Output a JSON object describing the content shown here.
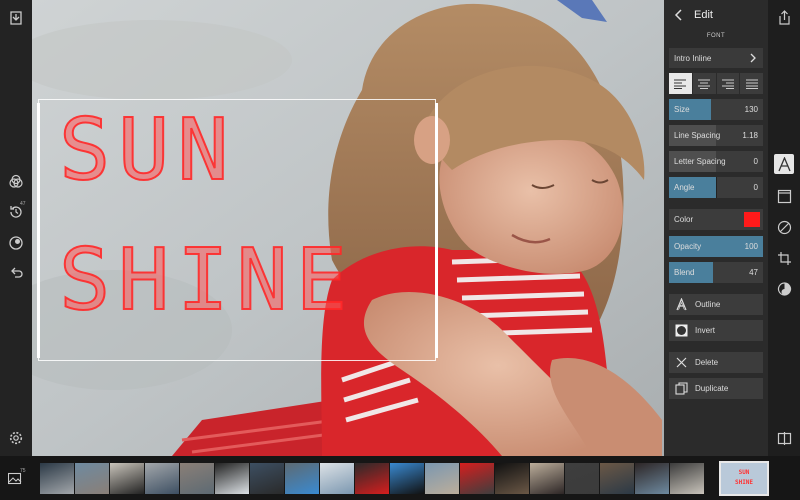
{
  "editor": {
    "back_icon": "chevron-left-icon",
    "title": "Edit",
    "section_label": "FONT",
    "font_name": "Intro Inline",
    "alignment_options": [
      "align-left",
      "align-center",
      "align-right",
      "align-justify"
    ],
    "alignment_selected": "align-left",
    "sliders": [
      {
        "id": "size",
        "label": "Size",
        "value": "130",
        "fill_fraction": 0.45,
        "active": true
      },
      {
        "id": "line-spacing",
        "label": "Line Spacing",
        "value": "1.18",
        "fill_fraction": 0.5,
        "active": false
      },
      {
        "id": "letter-spacing",
        "label": "Letter Spacing",
        "value": "0",
        "fill_fraction": 0.5,
        "active": false
      },
      {
        "id": "angle",
        "label": "Angle",
        "value": "0",
        "fill_fraction": 0.5,
        "active": true
      }
    ],
    "color": {
      "label": "Color",
      "value": "#ff1a1a"
    },
    "sliders2": [
      {
        "id": "opacity",
        "label": "Opacity",
        "value": "100",
        "fill_fraction": 1.0
      },
      {
        "id": "blend",
        "label": "Blend",
        "value": "47",
        "fill_fraction": 0.47
      }
    ],
    "actions": [
      {
        "id": "outline",
        "label": "Outline",
        "icon": "outline-a-icon"
      },
      {
        "id": "invert",
        "label": "Invert",
        "icon": "invert-circle-icon"
      },
      {
        "id": "delete",
        "label": "Delete",
        "icon": "close-x-icon"
      },
      {
        "id": "duplicate",
        "label": "Duplicate",
        "icon": "duplicate-icon"
      }
    ]
  },
  "canvas": {
    "text_lines": [
      "SUN",
      "SHINE"
    ],
    "text_color": "#ff2a2a"
  },
  "left_toolbar": {
    "icons": [
      "download-icon",
      "layers-icon",
      "history-icon",
      "brush-icon",
      "undo-icon",
      "settings-icon"
    ],
    "history_badge": "47"
  },
  "right_toolbar": {
    "icons": [
      "share-icon",
      "text-icon",
      "frame-icon",
      "no-filter-icon",
      "crop-icon",
      "overlay-icon",
      "compare-icon"
    ],
    "active": "text-icon"
  },
  "filmstrip": {
    "gallery_icon": "gallery-icon",
    "gallery_count": "75",
    "selected_thumb_text": [
      "SUN",
      "SHINE"
    ],
    "thumbnail_colors": [
      "#2b3946",
      "#6e8aa0",
      "#c9c4bb",
      "#a3a7ab",
      "#8a7f77",
      "#222",
      "#3d4f62",
      "#5d6a73",
      "#dde2e6",
      "#2a2a2a",
      "#3a8ad1",
      "#7b97b0",
      "#d61e1e",
      "#111",
      "#bcae9b",
      "#3e3e3e",
      "#6b5846",
      "#2d2626",
      "#3b3b3b",
      "#b9c9d9"
    ]
  }
}
